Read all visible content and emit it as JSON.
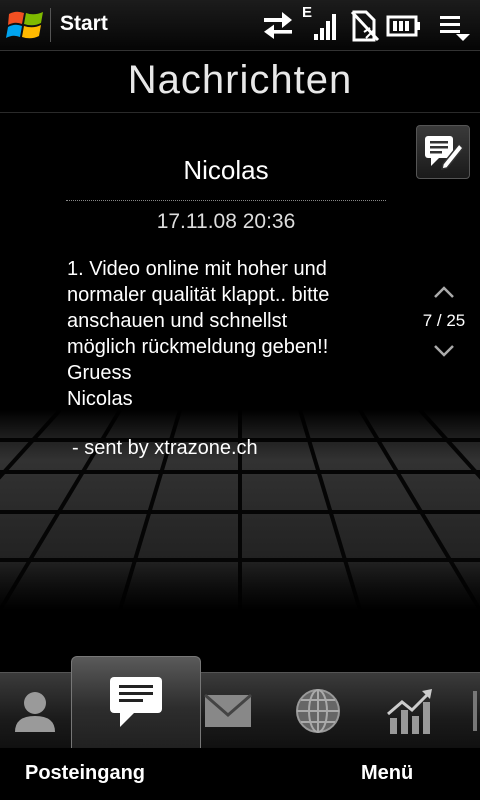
{
  "status_bar": {
    "start_label": "Start",
    "network_type": "E",
    "icons": [
      "windows-logo",
      "data-transfer-icon",
      "signal-strength-icon",
      "sound-off-icon",
      "battery-icon",
      "notifications-menu-icon"
    ]
  },
  "page_title": "Nachrichten",
  "message": {
    "sender": "Nicolas",
    "timestamp": "17.11.08 20:36",
    "body": "1. Video online mit hoher und\nnormaler qualität klappt.. bitte\nanschauen und schnellst\nmöglich rückmeldung geben!!\nGruess\nNicolas",
    "signature": "- sent by xtrazone.ch"
  },
  "pager": {
    "count": "7 / 25"
  },
  "tabs": [
    {
      "icon": "contacts-icon",
      "active": false
    },
    {
      "icon": "messages-icon",
      "active": true
    },
    {
      "icon": "mail-icon",
      "active": false
    },
    {
      "icon": "internet-icon",
      "active": false
    },
    {
      "icon": "stocks-icon",
      "active": false
    }
  ],
  "softkeys": {
    "left": "Posteingang",
    "right": "Menü"
  },
  "colors": {
    "background": "#000000",
    "text": "#ffffff",
    "tabbar": "#2a2a2a"
  }
}
